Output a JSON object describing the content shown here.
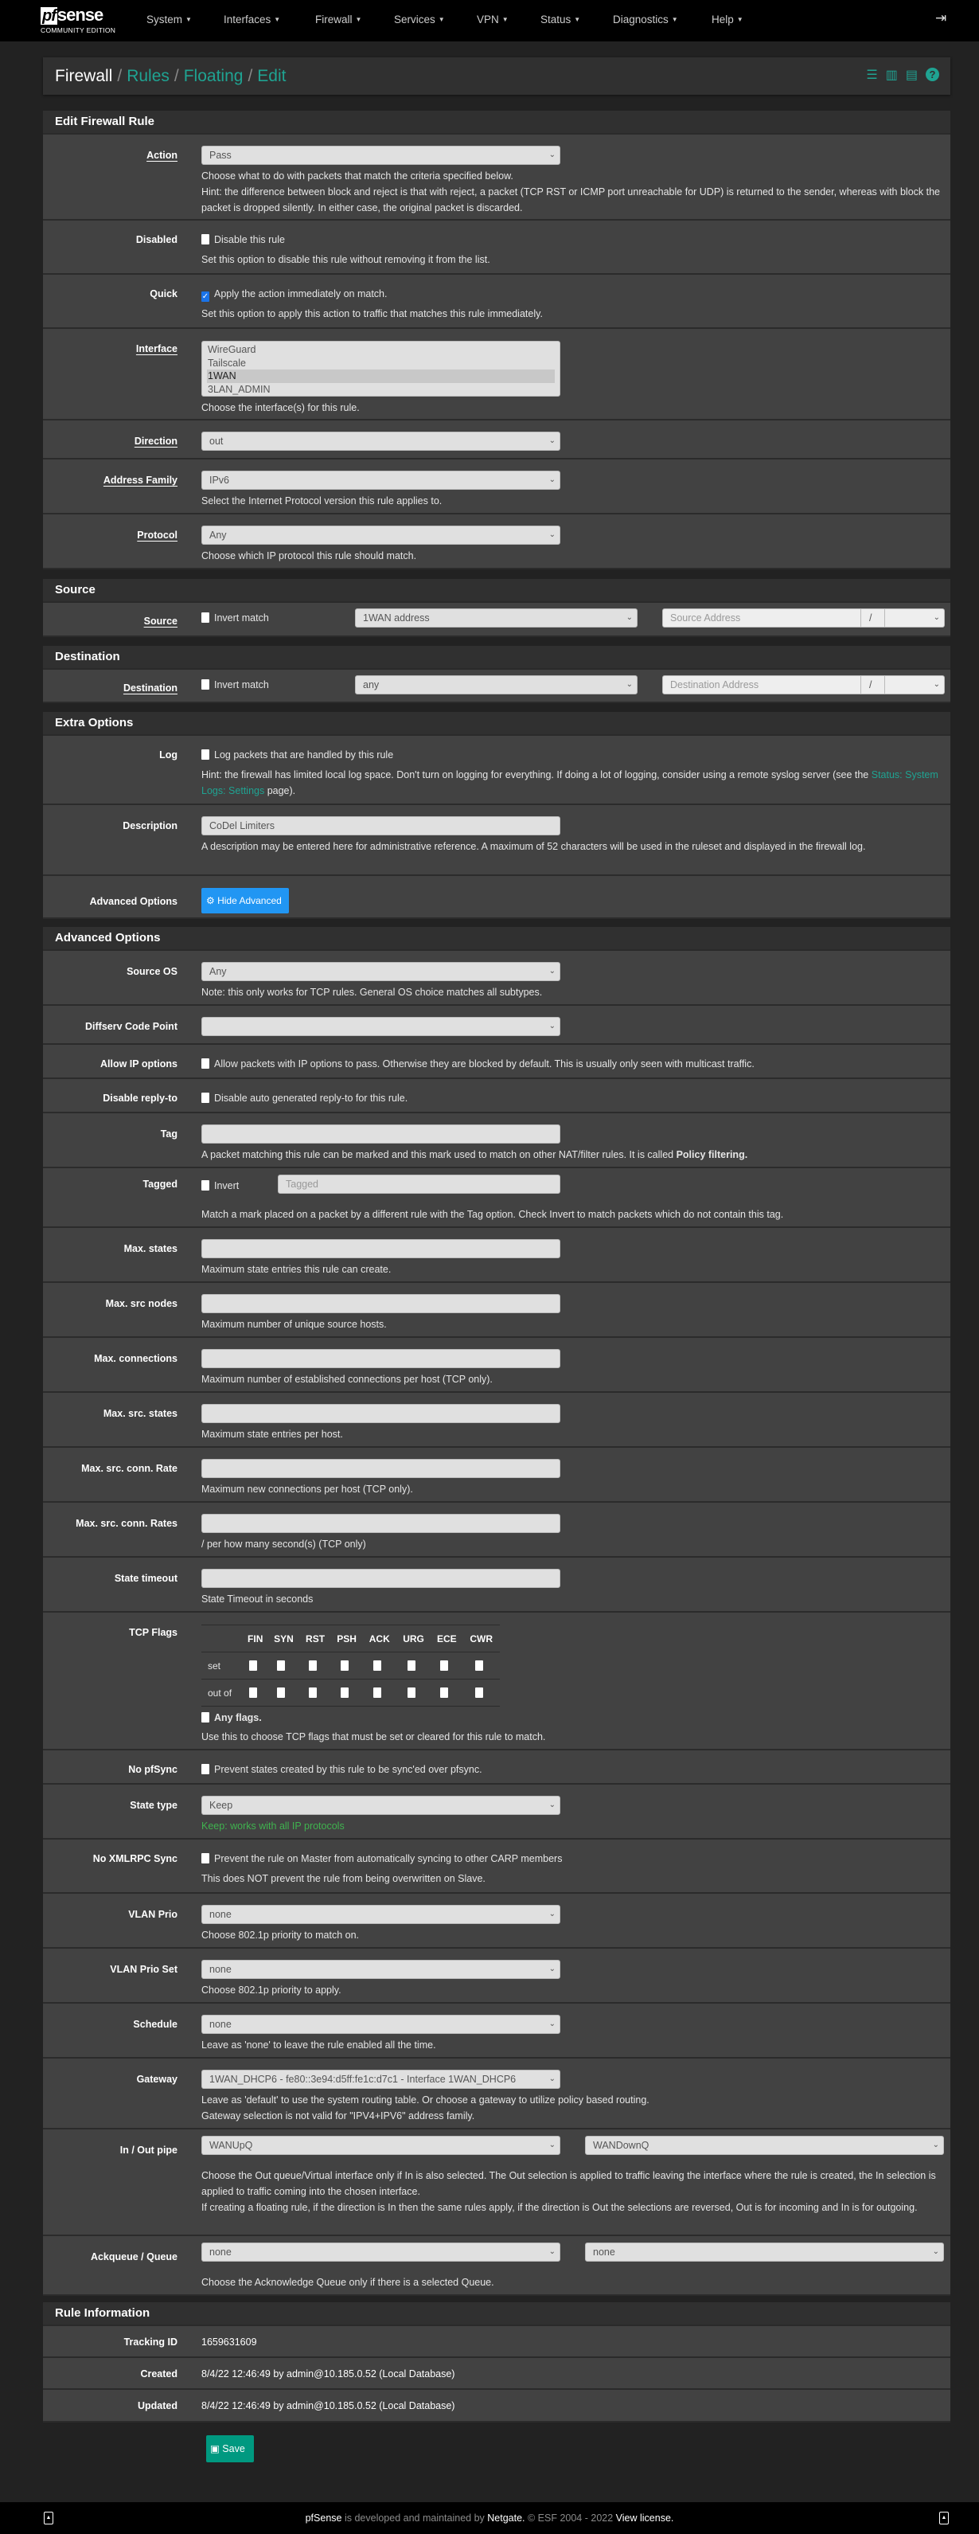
{
  "nav": {
    "logo_text": "pfsense",
    "logo_sub": "COMMUNITY EDITION",
    "items": [
      "System",
      "Interfaces",
      "Firewall",
      "Services",
      "VPN",
      "Status",
      "Diagnostics",
      "Help"
    ],
    "logout_icon": "sign-out-icon"
  },
  "breadcrumb": {
    "root": "Firewall",
    "links": [
      "Rules",
      "Floating",
      "Edit"
    ],
    "icons": [
      "sliders-icon",
      "bar-chart-icon",
      "list-icon",
      "help-icon"
    ]
  },
  "sections": [
    {
      "title": "Edit Firewall Rule",
      "rows": [
        {
          "type": "select",
          "label": "Action",
          "link": true,
          "value": "Pass",
          "help": [
            "Choose what to do with packets that match the criteria specified below.",
            [
              [
                "Hint: the difference between block and reject is that with reject, a packet (TCP RST or ICMP port unreachable for UDP) is returned to the sender, whereas with block the packet is dropped silently. In either case, the original packet is discarded."
              ]
            ]
          ]
        },
        {
          "type": "checkbox",
          "label": "Disabled",
          "checked": false,
          "text": "Disable this rule",
          "help": [
            "Set this option to disable this rule without removing it from the list."
          ]
        },
        {
          "type": "checkbox",
          "label": "Quick",
          "checked": true,
          "text": "Apply the action immediately on match.",
          "help": [
            "Set this option to apply this action to traffic that matches this rule immediately."
          ]
        },
        {
          "type": "multiselect",
          "label": "Interface",
          "link": true,
          "options": [
            "WireGuard",
            "Tailscale",
            "1WAN",
            "3LAN_ADMIN"
          ],
          "selected": "1WAN",
          "help": [
            "Choose the interface(s) for this rule."
          ]
        },
        {
          "type": "select",
          "label": "Direction",
          "link": true,
          "value": "out",
          "help": []
        },
        {
          "type": "select",
          "label": "Address Family",
          "link": true,
          "value": "IPv6",
          "help": [
            "Select the Internet Protocol version this rule applies to."
          ]
        },
        {
          "type": "select",
          "label": "Protocol",
          "link": true,
          "value": "Any",
          "help": [
            "Choose which IP protocol this rule should match."
          ]
        }
      ]
    },
    {
      "title": "Source",
      "rows": [
        {
          "type": "address",
          "label": "Source",
          "link": true,
          "invert_text": "Invert match",
          "value": "1WAN address",
          "placeholder": "Source Address",
          "slash": "/",
          "mask": ""
        }
      ]
    },
    {
      "title": "Destination",
      "rows": [
        {
          "type": "address",
          "label": "Destination",
          "link": true,
          "invert_text": "Invert match",
          "value": "any",
          "placeholder": "Destination Address",
          "slash": "/",
          "mask": ""
        }
      ]
    },
    {
      "title": "Extra Options",
      "rows": [
        {
          "type": "checkbox",
          "label": "Log",
          "checked": false,
          "text": "Log packets that are handled by this rule",
          "help": [
            [
              [
                "Hint: the firewall has limited local log space. Don't turn on logging for everything. If doing a lot of logging, consider using a remote syslog server (see the "
              ],
              [
                "Status: System Logs: Settings",
                "lk"
              ],
              [
                " page)."
              ]
            ]
          ]
        },
        {
          "type": "input",
          "label": "Description",
          "value": "CoDel Limiters",
          "placeholder": "",
          "help": [
            "A description may be entered here for administrative reference. A maximum of 52 characters will be used in the ruleset and displayed in the firewall log."
          ]
        },
        {
          "type": "button",
          "label": "Advanced Options",
          "text": "Hide Advanced",
          "icon": "gear-icon"
        }
      ]
    },
    {
      "title": "Advanced Options",
      "rows": [
        {
          "type": "select",
          "label": "Source OS",
          "value": "Any",
          "help": [
            "Note: this only works for TCP rules. General OS choice matches all subtypes."
          ]
        },
        {
          "type": "select",
          "label": "Diffserv Code Point",
          "value": "",
          "help": []
        },
        {
          "type": "checkbox",
          "label": "Allow IP options",
          "checked": false,
          "text": "Allow packets with IP options to pass. Otherwise they are blocked by default. This is usually only seen with multicast traffic.",
          "help": []
        },
        {
          "type": "checkbox",
          "label": "Disable reply-to",
          "checked": false,
          "text": "Disable auto generated reply-to for this rule.",
          "help": []
        },
        {
          "type": "input",
          "label": "Tag",
          "value": "",
          "placeholder": "",
          "help": [
            [
              [
                "A packet matching this rule can be marked and this mark used to match on other NAT/filter rules. It is called "
              ],
              [
                "Policy filtering.",
                "b"
              ]
            ]
          ]
        },
        {
          "type": "tagged",
          "label": "Tagged",
          "checked": false,
          "text": "Invert",
          "placeholder": "Tagged",
          "help": [
            "Match a mark placed on a packet by a different rule with the Tag option. Check Invert to match packets which do not contain this tag."
          ]
        },
        {
          "type": "input",
          "label": "Max. states",
          "value": "",
          "placeholder": "",
          "help": [
            "Maximum state entries this rule can create."
          ]
        },
        {
          "type": "input",
          "label": "Max. src nodes",
          "value": "",
          "placeholder": "",
          "help": [
            "Maximum number of unique source hosts."
          ]
        },
        {
          "type": "input",
          "label": "Max. connections",
          "value": "",
          "placeholder": "",
          "help": [
            "Maximum number of established connections per host (TCP only)."
          ]
        },
        {
          "type": "input",
          "label": "Max. src. states",
          "value": "",
          "placeholder": "",
          "help": [
            "Maximum state entries per host."
          ]
        },
        {
          "type": "input",
          "label": "Max. src. conn. Rate",
          "value": "",
          "placeholder": "",
          "help": [
            "Maximum new connections per host (TCP only)."
          ]
        },
        {
          "type": "input",
          "label": "Max. src. conn. Rates",
          "value": "",
          "placeholder": "",
          "help": [
            "/ per how many second(s) (TCP only)"
          ]
        },
        {
          "type": "input",
          "label": "State timeout",
          "value": "",
          "placeholder": "",
          "help": [
            "State Timeout in seconds"
          ]
        },
        {
          "type": "tcpflags",
          "label": "TCP Flags",
          "flags": [
            "FIN",
            "SYN",
            "RST",
            "PSH",
            "ACK",
            "URG",
            "ECE",
            "CWR"
          ],
          "row_labels": [
            "set",
            "out of"
          ],
          "any_text": "Any flags.",
          "any_checked": false,
          "help": [
            "Use this to choose TCP flags that must be set or cleared for this rule to match."
          ]
        },
        {
          "type": "checkbox",
          "label": "No pfSync",
          "checked": false,
          "text": "Prevent states created by this rule to be sync'ed over pfsync.",
          "help": []
        },
        {
          "type": "select",
          "label": "State type",
          "value": "Keep",
          "help": [
            [
              [
                "Keep: works with all IP protocols",
                "green"
              ]
            ]
          ]
        },
        {
          "type": "checkbox",
          "label": "No XMLRPC Sync",
          "checked": false,
          "text": "Prevent the rule on Master from automatically syncing to other CARP members",
          "help": [
            "This does NOT prevent the rule from being overwritten on Slave."
          ]
        },
        {
          "type": "select",
          "label": "VLAN Prio",
          "value": "none",
          "help": [
            "Choose 802.1p priority to match on."
          ]
        },
        {
          "type": "select",
          "label": "VLAN Prio Set",
          "value": "none",
          "help": [
            "Choose 802.1p priority to apply."
          ]
        },
        {
          "type": "select",
          "label": "Schedule",
          "value": "none",
          "help": [
            "Leave as 'none' to leave the rule enabled all the time."
          ]
        },
        {
          "type": "select",
          "label": "Gateway",
          "value": "1WAN_DHCP6 - fe80::3e94:d5ff:fe1c:d7c1 - Interface 1WAN_DHCP6",
          "help": [
            "Leave as 'default' to use the system routing table. Or choose a gateway to utilize policy based routing.",
            "Gateway selection is not valid for \"IPV4+IPV6\" address family."
          ]
        },
        {
          "type": "dualselect",
          "label": "In / Out pipe",
          "values": [
            "WANUpQ",
            "WANDownQ"
          ],
          "help": [
            "Choose the Out queue/Virtual interface only if In is also selected. The Out selection is applied to traffic leaving the interface where the rule is created, the In selection is applied to traffic coming into the chosen interface.",
            "If creating a floating rule, if the direction is In then the same rules apply, if the direction is Out the selections are reversed, Out is for incoming and In is for outgoing."
          ]
        },
        {
          "type": "dualselect",
          "label": "Ackqueue / Queue",
          "values": [
            "none",
            "none"
          ],
          "help": [
            "Choose the Acknowledge Queue only if there is a selected Queue."
          ]
        }
      ]
    },
    {
      "title": "Rule Information",
      "rows": [
        {
          "type": "info",
          "label": "Tracking ID",
          "value": "1659631609"
        },
        {
          "type": "info",
          "label": "Created",
          "value": "8/4/22 12:46:49 by admin@10.185.0.52 (Local Database)"
        },
        {
          "type": "info",
          "label": "Updated",
          "value": "8/4/22 12:46:49 by admin@10.185.0.52 (Local Database)"
        }
      ]
    }
  ],
  "save": {
    "label": "Save",
    "icon": "save-icon"
  },
  "footer": {
    "brand": "pfSense",
    "text": " is developed and maintained by ",
    "company": "Netgate.",
    "copyright": " © ESF 2004 - 2022 ",
    "license": "View license.",
    "icons": [
      "scroll-top-icon",
      "scroll-top-icon"
    ]
  },
  "colors": {
    "accent": "#1fa392",
    "button_blue": "#2196f3",
    "save_green": "#009980",
    "checkbox_checked": "#1a73e8",
    "panel": "#424242",
    "panel_header": "#303030",
    "page": "#222222"
  }
}
